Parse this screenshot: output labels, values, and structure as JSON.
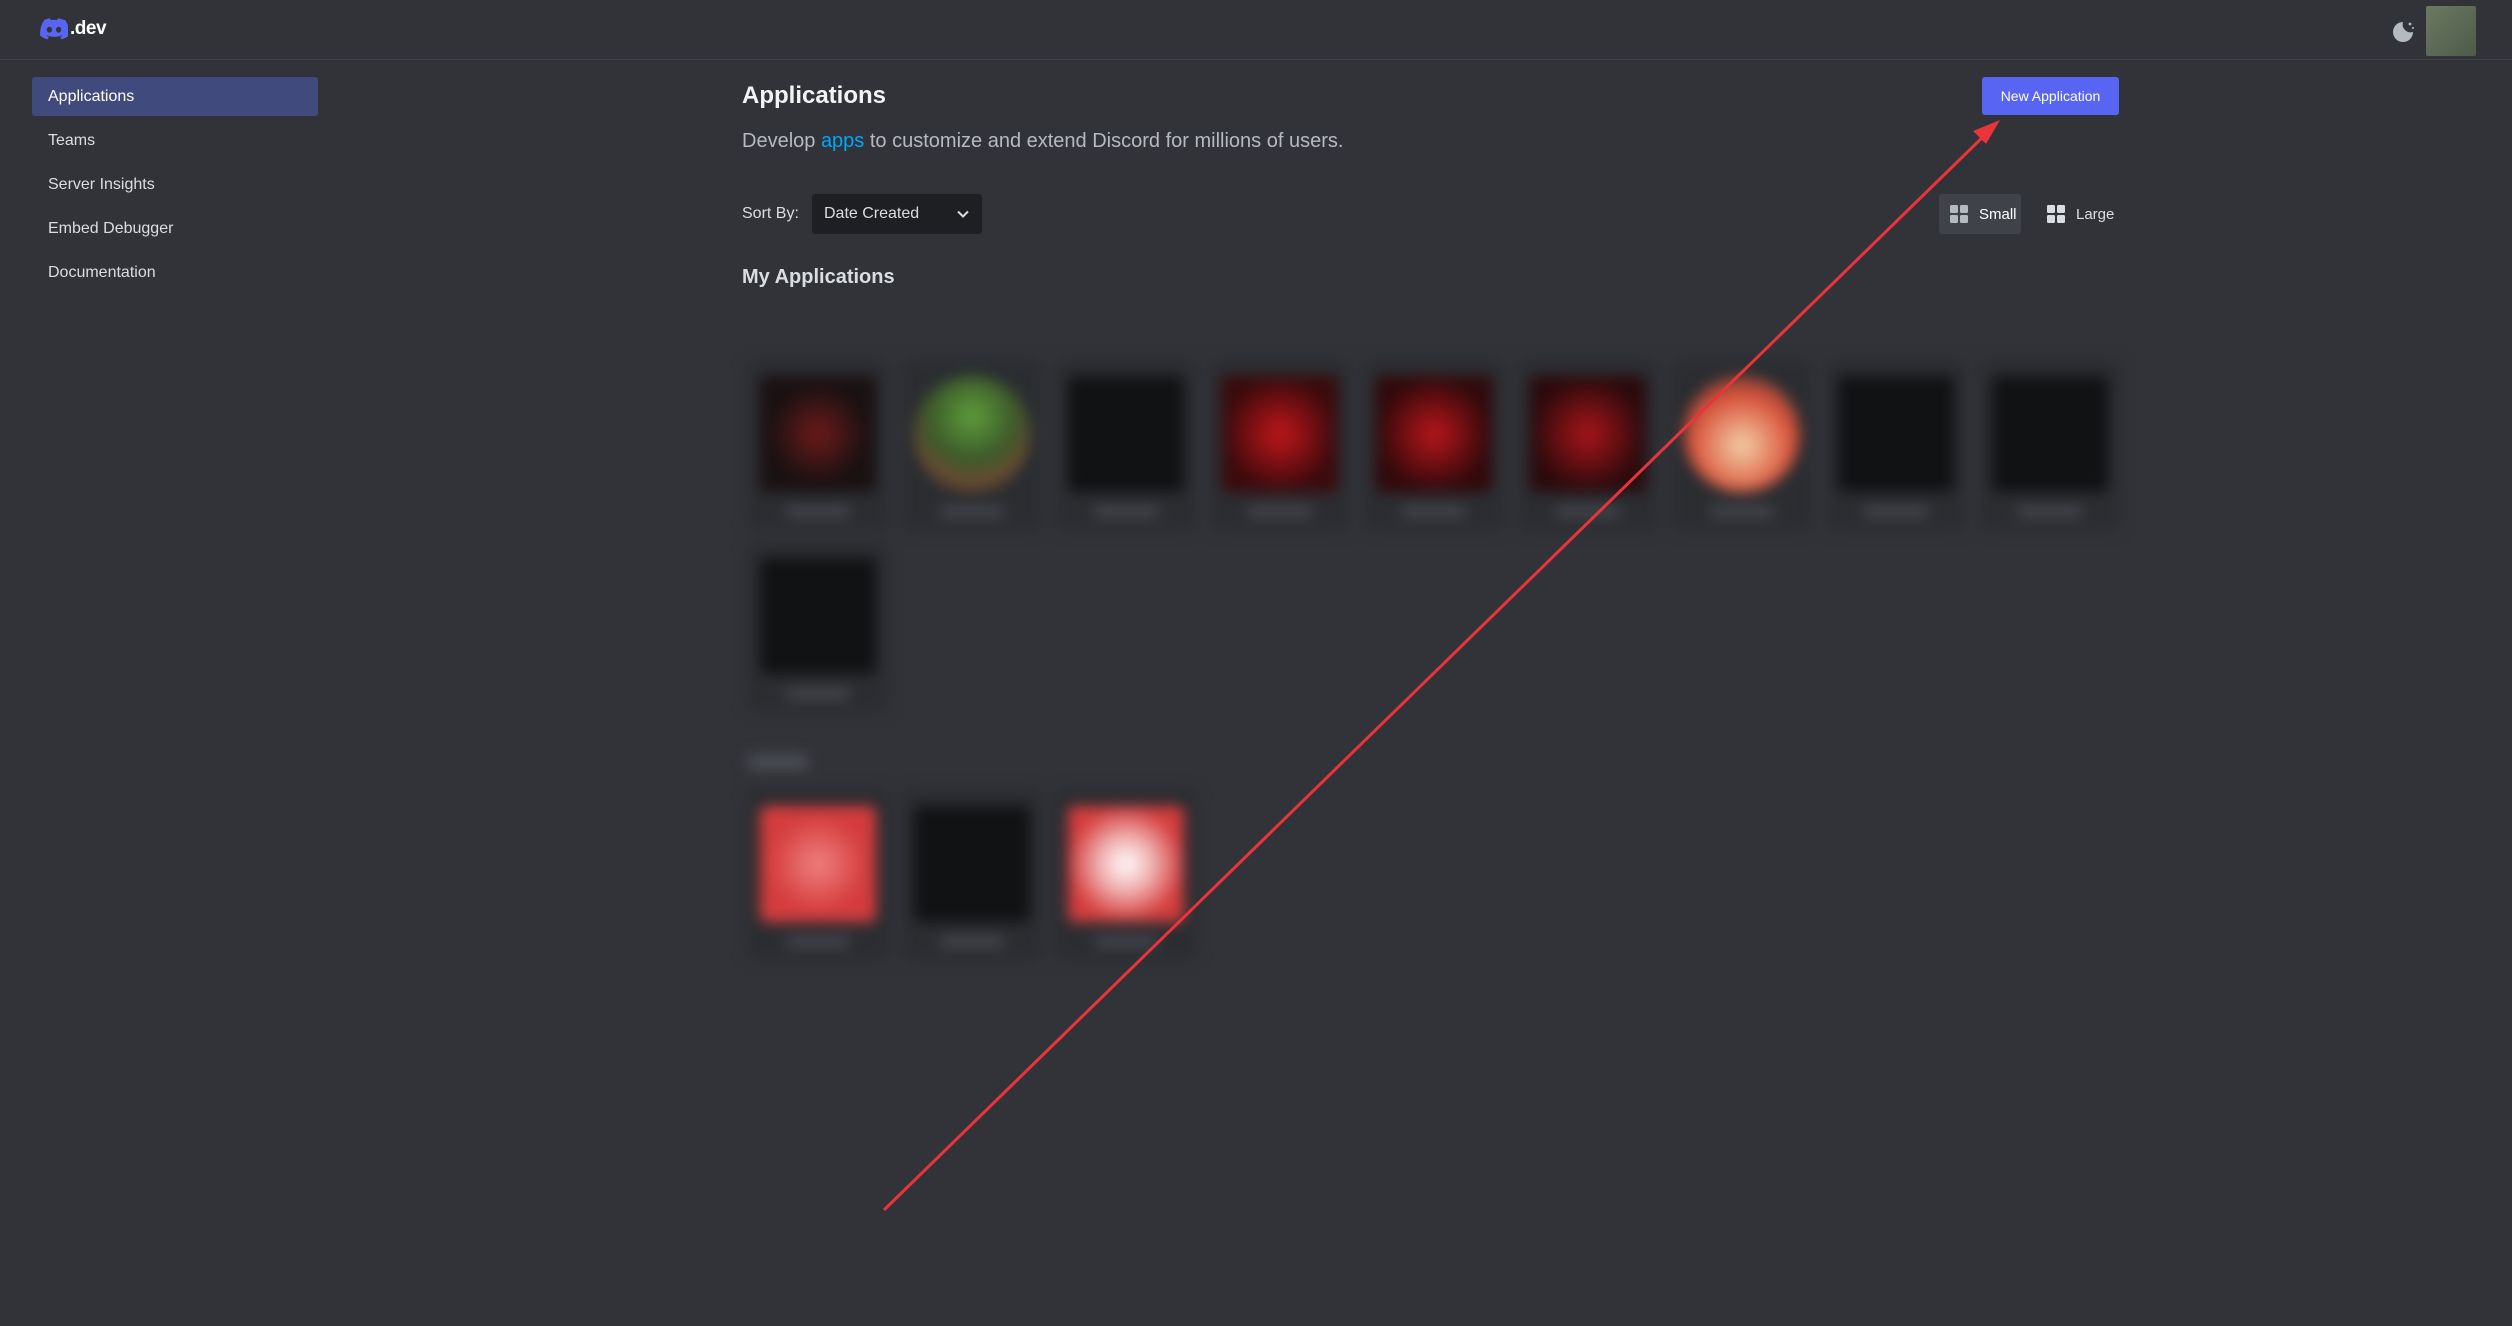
{
  "topbar": {
    "logo_text": ".dev",
    "icons": {
      "logo": "discord-logo-icon",
      "theme": "moon-icon"
    }
  },
  "sidebar": {
    "items": [
      {
        "label": "Applications",
        "active": true
      },
      {
        "label": "Teams",
        "active": false
      },
      {
        "label": "Server Insights",
        "active": false
      },
      {
        "label": "Embed Debugger",
        "active": false
      },
      {
        "label": "Documentation",
        "active": false
      }
    ]
  },
  "main": {
    "title": "Applications",
    "subtitle_before": "Develop ",
    "subtitle_link": "apps",
    "subtitle_after": " to customize and extend Discord for millions of users.",
    "new_app_button": "New Application",
    "sort_label": "Sort By:",
    "sort_value": "Date Created",
    "view_small_label": "Small",
    "view_large_label": "Large",
    "section_title": "My Applications"
  },
  "colors": {
    "background": "#313338",
    "accent": "#5865f2",
    "sidebar_active": "#404a7d",
    "link": "#00a8fc",
    "annotation_arrow": "#e8343a"
  }
}
